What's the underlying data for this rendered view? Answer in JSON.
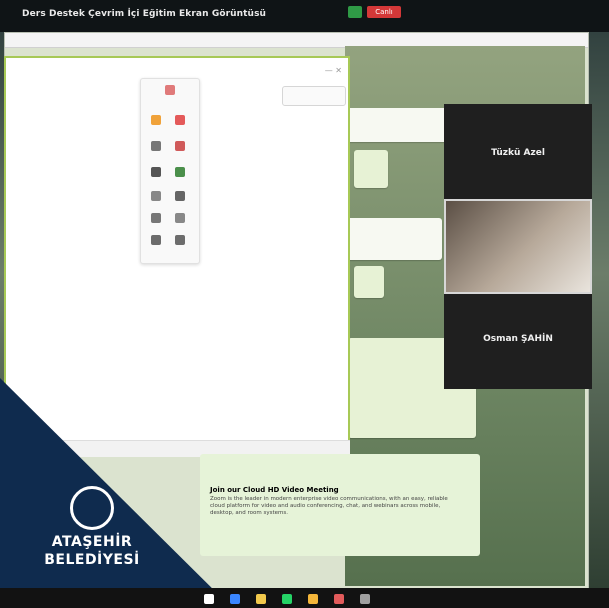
{
  "window": {
    "title": "Ders Destek Çevrim İçi Eğitim Ekran Görüntüsü",
    "live_badge": "Canlı"
  },
  "browser": {
    "url": ""
  },
  "whiteboard": {
    "zoom_pill": {
      "left": "",
      "right": ""
    },
    "bottom_bar": [
      "",
      "",
      ""
    ]
  },
  "chat": {
    "message1": "",
    "message2": "",
    "message3": "",
    "link_text": "",
    "link_header": "",
    "card_title": "Join our Cloud HD Video Meeting",
    "card_body": "Zoom is the leader in modern enterprise video communications, with an easy, reliable cloud platform for video and audio conferencing, chat, and webinars across mobile, desktop, and room systems."
  },
  "video": {
    "participants": [
      {
        "name": "Tüzkü Azel"
      },
      {
        "name": ""
      },
      {
        "name": "Osman ŞAHİN"
      }
    ]
  },
  "promo": {
    "logo_text_line1": "ATAŞEHİR",
    "logo_text_line2": "BELEDİYESİ",
    "logo_text_line3": ""
  },
  "colors": {
    "whiteboard_border": "#a7c956",
    "promo_background": "#0f2b4e"
  }
}
